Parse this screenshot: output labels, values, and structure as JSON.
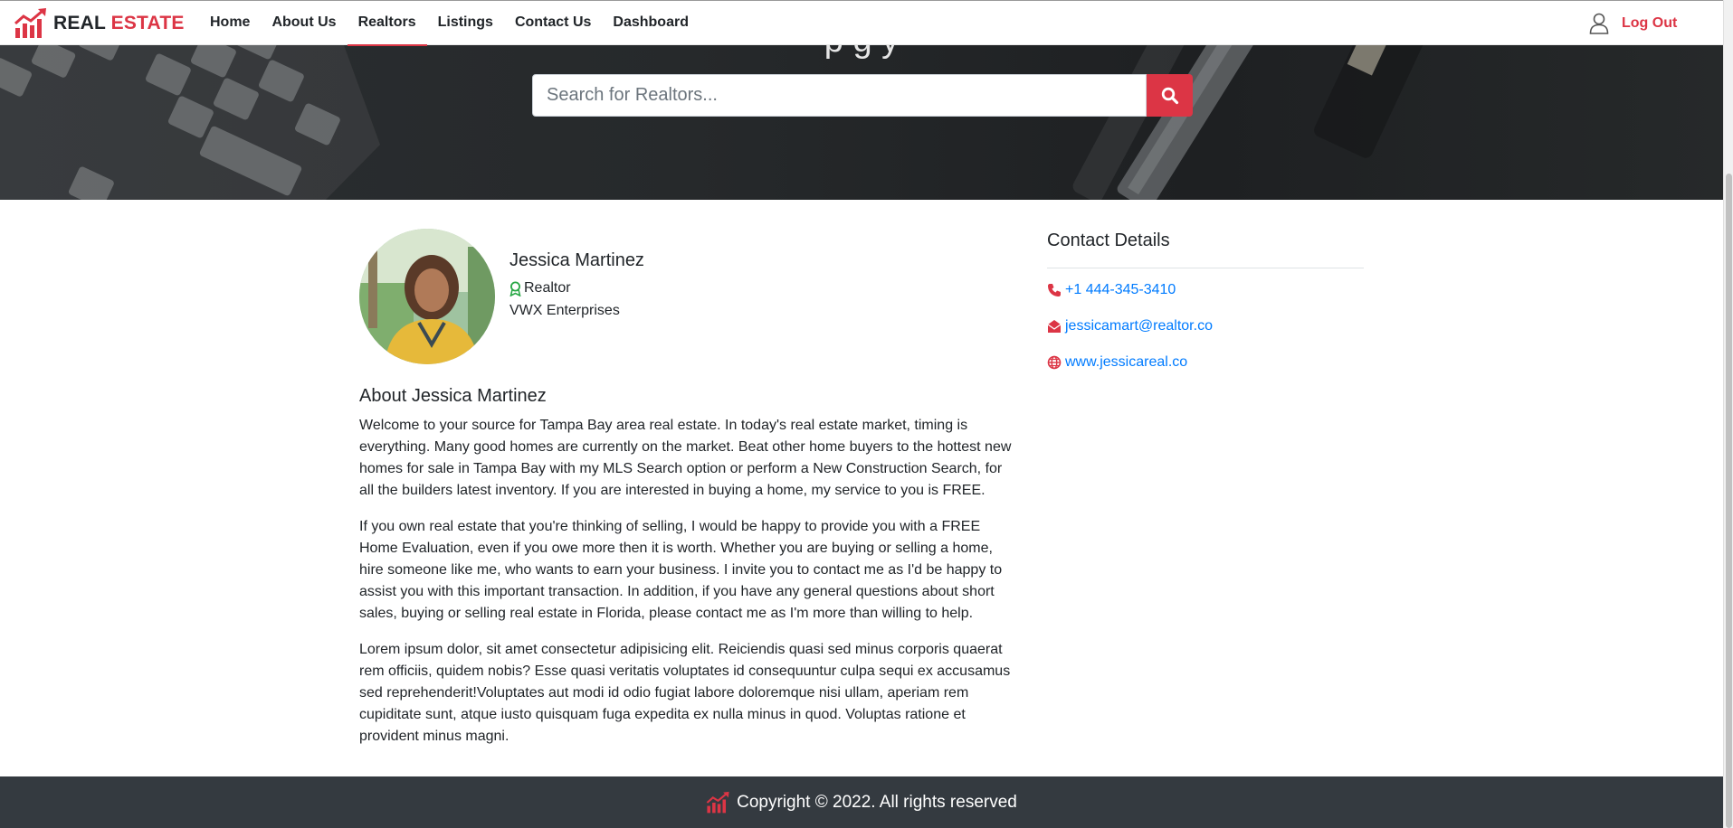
{
  "brand": {
    "part1": "REAL",
    "part2": "ESTATE"
  },
  "nav": {
    "items": [
      {
        "label": "Home"
      },
      {
        "label": "About Us"
      },
      {
        "label": "Realtors"
      },
      {
        "label": "Listings"
      },
      {
        "label": "Contact Us"
      },
      {
        "label": "Dashboard"
      }
    ],
    "active": "Realtors",
    "user_icon": "user-icon",
    "logout_label": "Log Out"
  },
  "hero": {
    "title_partial": "p      g     y",
    "search": {
      "placeholder": "Search for Realtors...",
      "value": "",
      "button_icon": "search-icon"
    }
  },
  "profile": {
    "name": "Jessica Martinez",
    "role_icon": "award-icon",
    "role": "Realtor",
    "company": "VWX Enterprises"
  },
  "about": {
    "title": "About Jessica Martinez",
    "paragraphs": [
      "Welcome to your source for Tampa Bay area real estate. In today's real estate market, timing is everything. Many good homes are currently on the market. Beat other home buyers to the hottest new homes for sale in Tampa Bay with my MLS Search option or perform a New Construction Search, for all the builders latest inventory. If you are interested in buying a home, my service to you is FREE.",
      "If you own real estate that you're thinking of selling, I would be happy to provide you with a FREE Home Evaluation, even if you owe more then it is worth. Whether you are buying or selling a home, hire someone like me, who wants to earn your business. I invite you to contact me as I'd be happy to assist you with this important transaction. In addition, if you have any general questions about short sales, buying or selling real estate in Florida, please contact me as I'm more than willing to help.",
      "Lorem ipsum dolor, sit amet consectetur adipisicing elit. Reiciendis quasi sed minus corporis quaerat rem officiis, quidem nobis? Esse quasi veritatis voluptates id consequuntur culpa sequi ex accusamus sed reprehenderit!Voluptates aut modi id odio fugiat labore doloremque nisi ullam, aperiam rem cupiditate sunt, atque iusto quisquam fuga expedita ex nulla minus in quod. Voluptas ratione et provident minus magni."
    ]
  },
  "contact": {
    "title": "Contact Details",
    "phone": {
      "icon": "phone-icon",
      "value": "+1 444-345-3410"
    },
    "email": {
      "icon": "envelope-icon",
      "value": "jessicamart@realtor.co"
    },
    "website": {
      "icon": "globe-icon",
      "value": "www.jessicareal.co"
    }
  },
  "footer": {
    "icon": "chart-logo-icon",
    "text": "Copyright © 2022. All rights reserved"
  },
  "colors": {
    "accent": "#dc3545",
    "link": "#007bff",
    "footer_bg": "#343a40",
    "text": "#212529"
  }
}
